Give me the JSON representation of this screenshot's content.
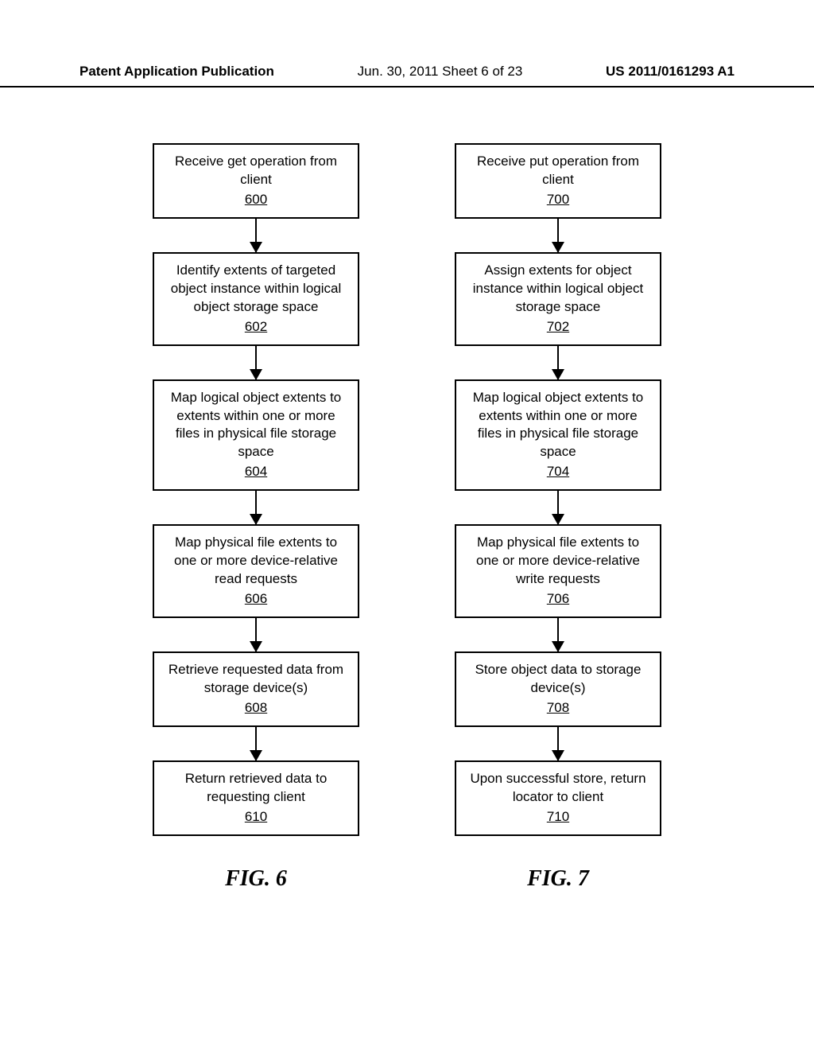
{
  "header": {
    "left": "Patent Application Publication",
    "center": "Jun. 30, 2011  Sheet 6 of 23",
    "right": "US 2011/0161293 A1"
  },
  "flowcharts": {
    "left": {
      "label": "FIG. 6",
      "steps": [
        {
          "text": "Receive get operation from client",
          "ref": "600"
        },
        {
          "text": "Identify extents of targeted object instance within logical object storage space",
          "ref": "602"
        },
        {
          "text": "Map logical object extents to extents within one or more files in physical file storage space",
          "ref": "604"
        },
        {
          "text": "Map physical file extents to one or more device-relative read requests",
          "ref": "606"
        },
        {
          "text": "Retrieve requested data from storage device(s)",
          "ref": "608"
        },
        {
          "text": "Return retrieved data to requesting client",
          "ref": "610"
        }
      ]
    },
    "right": {
      "label": "FIG. 7",
      "steps": [
        {
          "text": "Receive put operation from client",
          "ref": "700"
        },
        {
          "text": "Assign extents for object instance within logical object storage space",
          "ref": "702"
        },
        {
          "text": "Map logical object extents to extents within one or more files in physical file storage space",
          "ref": "704"
        },
        {
          "text": "Map physical file extents to one or more device-relative write requests",
          "ref": "706"
        },
        {
          "text": "Store object data to storage device(s)",
          "ref": "708"
        },
        {
          "text": "Upon successful store, return locator to client",
          "ref": "710"
        }
      ]
    }
  }
}
